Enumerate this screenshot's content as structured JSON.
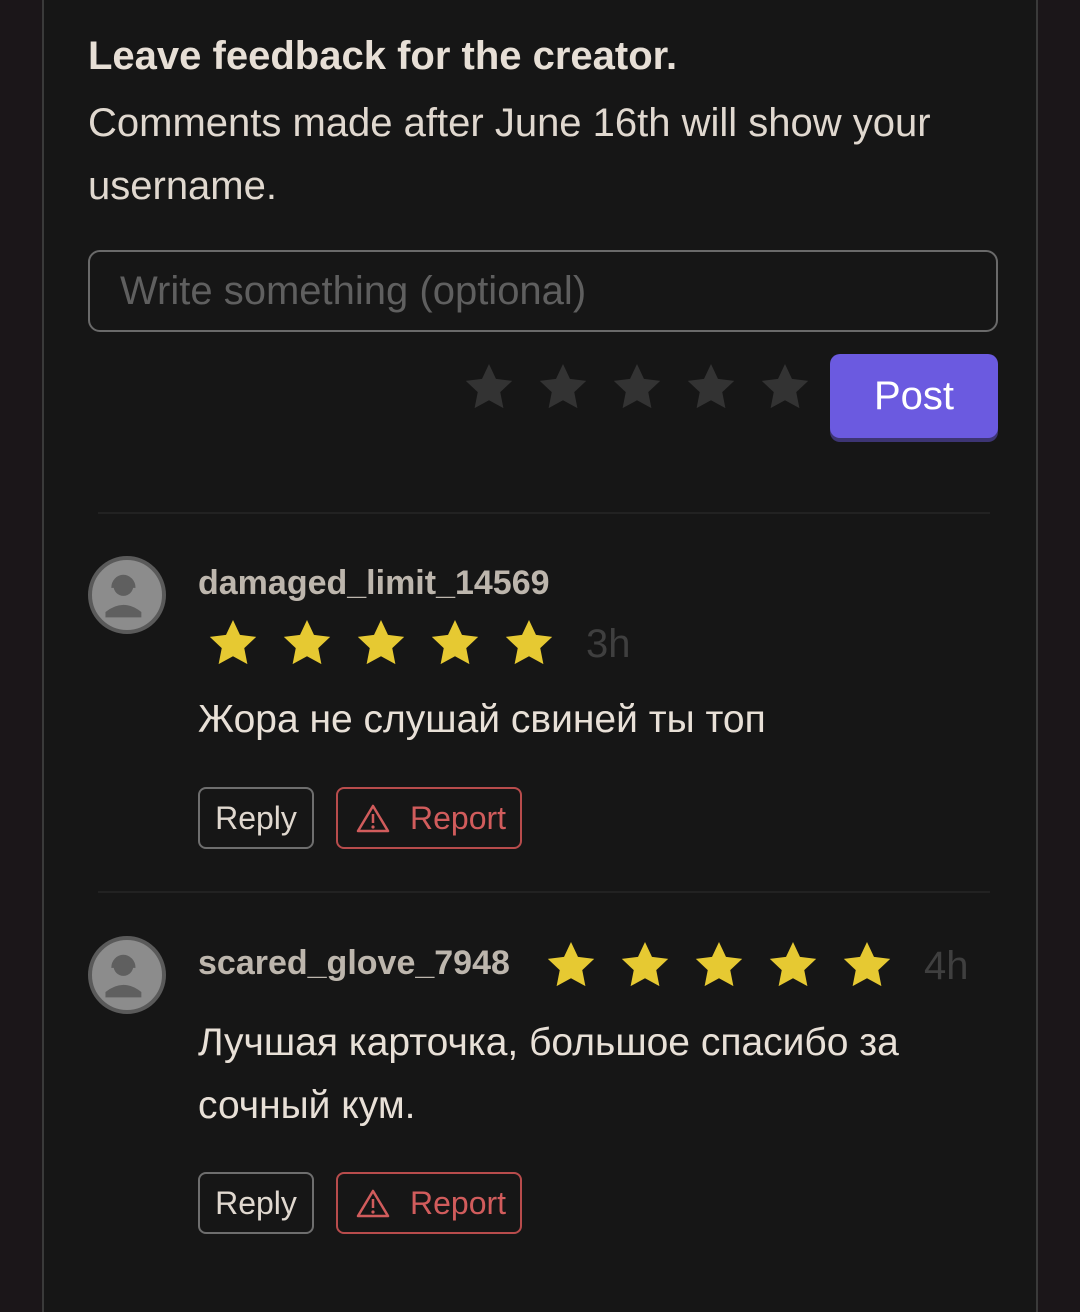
{
  "feedback": {
    "title": "Leave feedback for the creator.",
    "subtitle": "Comments made after June 16th will show your username.",
    "input_placeholder": "Write something (optional)",
    "input_value": "",
    "rating_selected": 0,
    "rating_max": 5,
    "post_label": "Post"
  },
  "comments": [
    {
      "username": "damaged_limit_14569",
      "rating": 5,
      "time": "3h",
      "text": "Жора не слушай свиней ты топ",
      "reply_label": "Reply",
      "report_label": "Report"
    },
    {
      "username": "scared_glove_7948",
      "rating": 5,
      "time": "4h",
      "text": "Лучшая карточка, большое спасибо за сочный кум.",
      "reply_label": "Reply",
      "report_label": "Report"
    }
  ],
  "icons": {
    "star": "star-icon",
    "avatar": "user-avatar-icon",
    "report": "warning-triangle-icon"
  },
  "colors": {
    "background": "#161616",
    "accent": "#6b5ae0",
    "star_filled": "#e6c932",
    "star_empty": "#333333",
    "report": "#d15c5c"
  }
}
